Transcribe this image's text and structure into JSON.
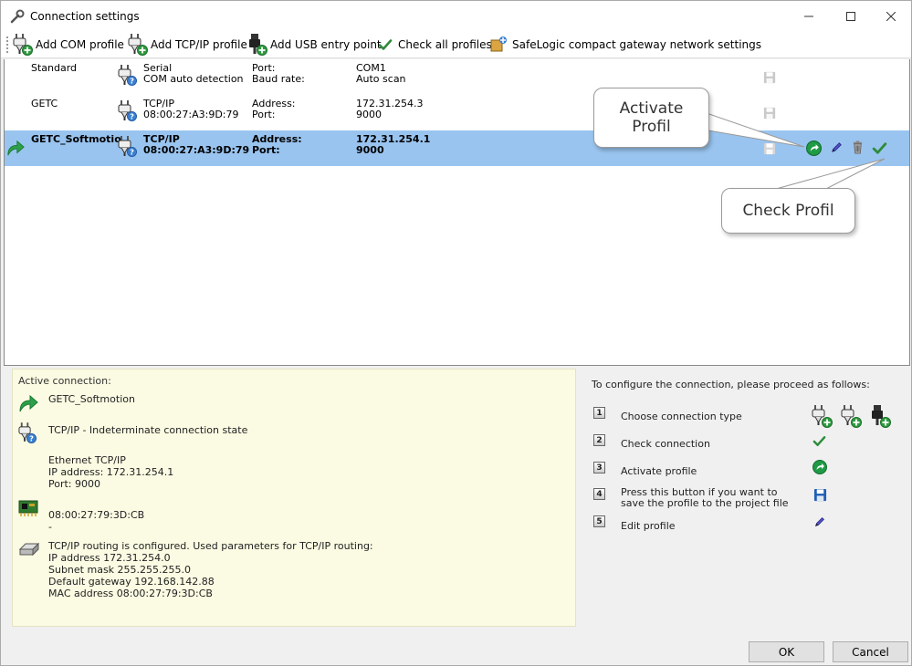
{
  "window": {
    "title": "Connection settings"
  },
  "toolbar": {
    "add_com": "Add COM profile",
    "add_tcp": "Add TCP/IP profile",
    "add_usb": "Add USB entry point",
    "check_all": "Check all profiles",
    "safelogic": "SafeLogic compact gateway network settings"
  },
  "profiles": [
    {
      "name": "Standard",
      "type_line1": "Serial",
      "type_line2": "COM auto detection",
      "label1": "Port:",
      "label2": "Baud rate:",
      "value1": "COM1",
      "value2": "Auto scan",
      "icon": "serial-plug-icon"
    },
    {
      "name": "GETC",
      "type_line1": "TCP/IP",
      "type_line2": "08:00:27:A3:9D:79",
      "label1": "Address:",
      "label2": "Port:",
      "value1": "172.31.254.3",
      "value2": "9000",
      "icon": "tcp-plug-icon"
    },
    {
      "name": "GETC_Softmotio",
      "type_line1": "TCP/IP",
      "type_line2": "08:00:27:A3:9D:79",
      "label1": "Address:",
      "label2": "Port:",
      "value1": "172.31.254.1",
      "value2": "9000",
      "icon": "tcp-plug-icon",
      "active": true
    }
  ],
  "callouts": {
    "activate": "Activate Profil",
    "check": "Check Profil"
  },
  "active_connection": {
    "title": "Active connection:",
    "profile_name": "GETC_Softmotion",
    "state": "TCP/IP - Indeterminate connection state",
    "details": [
      "Ethernet TCP/IP",
      "IP address: 172.31.254.1",
      "Port: 9000"
    ],
    "mac": "08:00:27:79:3D:CB",
    "mac_sub": "-",
    "routing": [
      "TCP/IP routing is configured. Used parameters for TCP/IP routing:",
      "IP address 172.31.254.0",
      "Subnet mask 255.255.255.0",
      "Default gateway 192.168.142.88",
      "MAC address 08:00:27:79:3D:CB"
    ]
  },
  "help": {
    "title": "To configure the connection, please proceed as follows:",
    "steps": [
      {
        "num": "1",
        "text": "Choose connection type"
      },
      {
        "num": "2",
        "text": "Check connection"
      },
      {
        "num": "3",
        "text": "Activate profile"
      },
      {
        "num": "4",
        "text": "Press this button if you want to save the profile to the project file"
      },
      {
        "num": "5",
        "text": "Edit profile"
      }
    ]
  },
  "buttons": {
    "ok": "OK",
    "cancel": "Cancel"
  },
  "colors": {
    "selected_row": "#99c4ef",
    "active_panel_bg": "#fbfbe3",
    "window_bg": "#f0f0f0",
    "accent_green": "#1a8a3a"
  }
}
